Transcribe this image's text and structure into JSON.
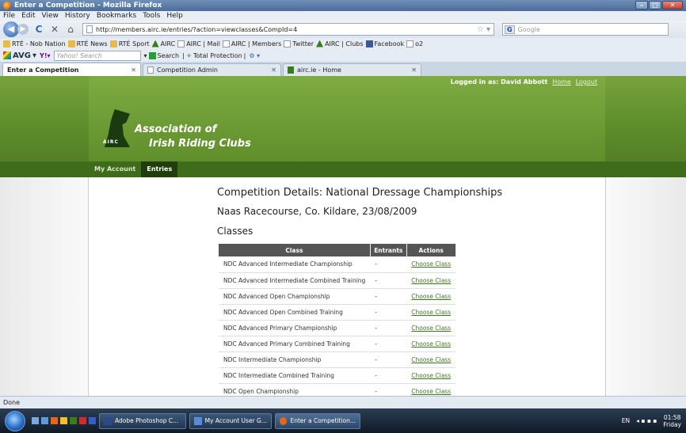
{
  "window": {
    "title": "Enter a Competition - Mozilla Firefox"
  },
  "menu": [
    "File",
    "Edit",
    "View",
    "History",
    "Bookmarks",
    "Tools",
    "Help"
  ],
  "nav": {
    "url": "http://members.airc.ie/entries/?action=viewclasses&CompId=4",
    "search_placeholder": "Google",
    "search_engine": "G"
  },
  "bookmarks": [
    {
      "label": "RTÉ - Nob Nation",
      "icon": "folder"
    },
    {
      "label": "RTÉ News",
      "icon": "folder"
    },
    {
      "label": "RTÉ Sport",
      "icon": "folder"
    },
    {
      "label": "AIRC",
      "icon": "airc"
    },
    {
      "label": "AIRC | Mail",
      "icon": "page"
    },
    {
      "label": "AIRC | Members",
      "icon": "page"
    },
    {
      "label": "Twitter",
      "icon": "page"
    },
    {
      "label": "AIRC | Clubs",
      "icon": "airc"
    },
    {
      "label": "Facebook",
      "icon": "fb"
    },
    {
      "label": "o2",
      "icon": "page"
    }
  ],
  "avg": {
    "logo": "AVG",
    "yahoo_placeholder": "Yahoo! Search",
    "search_label": "Search",
    "protection_label": "Total Protection"
  },
  "tabs": [
    {
      "label": "Enter a Competition",
      "active": true
    },
    {
      "label": "Competition Admin",
      "active": false
    },
    {
      "label": "airc.ie - Home",
      "active": false
    }
  ],
  "site": {
    "org_line1": "Association of",
    "org_line2": "Irish Riding Clubs",
    "logo_text": "AIRC",
    "logged_in_text": "Logged in as: David Abbott",
    "home_link": "Home",
    "logout_link": "Logout",
    "subnav": [
      "My Account",
      "Entries"
    ]
  },
  "competition": {
    "title": "Competition Details: National Dressage Championships",
    "venue_date": "Naas Racecourse, Co. Kildare, 23/08/2009",
    "classes_heading": "Classes"
  },
  "table": {
    "headers": [
      "Class",
      "Entrants",
      "Actions"
    ],
    "rows": [
      {
        "class": "NDC Advanced Intermediate Championship",
        "entrants": "-",
        "action": "Choose Class"
      },
      {
        "class": "NDC Advanced Intermediate Combined Training",
        "entrants": "-",
        "action": "Choose Class"
      },
      {
        "class": "NDC Advanced Open Championship",
        "entrants": "-",
        "action": "Choose Class"
      },
      {
        "class": "NDC Advanced Open Combined Training",
        "entrants": "-",
        "action": "Choose Class"
      },
      {
        "class": "NDC Advanced Primary Championship",
        "entrants": "-",
        "action": "Choose Class"
      },
      {
        "class": "NDC Advanced Primary Combined Training",
        "entrants": "-",
        "action": "Choose Class"
      },
      {
        "class": "NDC Intermediate Championship",
        "entrants": "-",
        "action": "Choose Class"
      },
      {
        "class": "NDC Intermediate Combined Training",
        "entrants": "-",
        "action": "Choose Class"
      },
      {
        "class": "NDC Open Championship",
        "entrants": "-",
        "action": "Choose Class"
      }
    ]
  },
  "status": {
    "text": "Done"
  },
  "taskbar": {
    "tasks": [
      "Adobe Photoshop C...",
      "My Account User G...",
      "Enter a Competition..."
    ],
    "lang": "EN",
    "time": "01:58",
    "day": "Friday"
  },
  "colors": {
    "brand_green": "#6a9a33",
    "nav_dark": "#3e6c1a",
    "link_green": "#3c7a1c"
  }
}
